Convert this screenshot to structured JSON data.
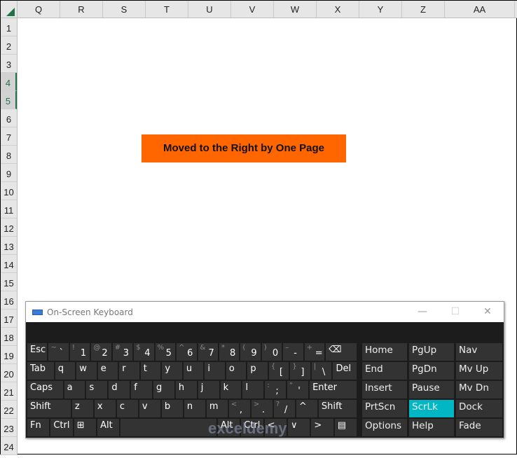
{
  "sheet": {
    "columns": [
      "Q",
      "R",
      "S",
      "T",
      "U",
      "V",
      "W",
      "X",
      "Y",
      "Z",
      "AA"
    ],
    "rows": [
      "1",
      "2",
      "3",
      "4",
      "5",
      "6",
      "7",
      "8",
      "9",
      "10",
      "11",
      "12",
      "13",
      "14",
      "15",
      "16",
      "17",
      "18",
      "19",
      "20",
      "21",
      "22",
      "23",
      "24"
    ],
    "selected_rows": [
      "4",
      "5"
    ],
    "banner": "Moved to the Right by One Page",
    "accent": "#ff6600"
  },
  "osk": {
    "title": "On-Screen Keyboard",
    "minimize": "—",
    "maximize": "☐",
    "close": "✕",
    "rows": [
      [
        [
          "Esc",
          "",
          1
        ],
        [
          "`",
          "~",
          1
        ],
        [
          "1",
          "!",
          1
        ],
        [
          "2",
          "@",
          1
        ],
        [
          "3",
          "#",
          1
        ],
        [
          "4",
          "$",
          1
        ],
        [
          "5",
          "%",
          1
        ],
        [
          "6",
          "^",
          1
        ],
        [
          "7",
          "&",
          1
        ],
        [
          "8",
          "*",
          1
        ],
        [
          "9",
          "(",
          1
        ],
        [
          "0",
          ")",
          1
        ],
        [
          "-",
          "–",
          1
        ],
        [
          "=",
          "+",
          1
        ],
        [
          "⌫",
          "",
          1.75
        ]
      ],
      [
        [
          "Tab",
          "",
          1.45
        ],
        [
          "q",
          "",
          1
        ],
        [
          "w",
          "",
          1
        ],
        [
          "e",
          "",
          1
        ],
        [
          "r",
          "",
          1
        ],
        [
          "t",
          "",
          1
        ],
        [
          "y",
          "",
          1
        ],
        [
          "u",
          "",
          1
        ],
        [
          "i",
          "",
          1
        ],
        [
          "o",
          "",
          1
        ],
        [
          "p",
          "",
          1
        ],
        [
          "[",
          "{",
          1
        ],
        [
          "]",
          "}",
          1
        ],
        [
          "\\",
          "|",
          1
        ],
        [
          "Del",
          "",
          1.25
        ]
      ],
      [
        [
          "Caps",
          "",
          1.95
        ],
        [
          "a",
          "",
          1
        ],
        [
          "s",
          "",
          1
        ],
        [
          "d",
          "",
          1
        ],
        [
          "f",
          "",
          1
        ],
        [
          "g",
          "",
          1
        ],
        [
          "h",
          "",
          1
        ],
        [
          "j",
          "",
          1
        ],
        [
          "k",
          "",
          1
        ],
        [
          "l",
          "",
          1
        ],
        [
          ";",
          ":",
          1
        ],
        [
          "'",
          "\"",
          1
        ],
        [
          "Enter",
          "",
          2.7
        ]
      ],
      [
        [
          "Shift",
          "",
          2.45
        ],
        [
          "z",
          "",
          1
        ],
        [
          "x",
          "",
          1
        ],
        [
          "c",
          "",
          1
        ],
        [
          "v",
          "",
          1
        ],
        [
          "b",
          "",
          1
        ],
        [
          "n",
          "",
          1
        ],
        [
          "m",
          "",
          1
        ],
        [
          ",",
          "<",
          1
        ],
        [
          ".",
          ">",
          1
        ],
        [
          "/",
          "?",
          1
        ],
        [
          "^",
          "",
          1
        ],
        [
          "Shift",
          "",
          2.1
        ]
      ],
      [
        [
          "Fn",
          "",
          1
        ],
        [
          "Ctrl",
          "",
          1
        ],
        [
          "⊞",
          "",
          1
        ],
        [
          "Alt",
          "",
          1
        ],
        [
          "",
          "",
          5.5
        ],
        [
          "Alt",
          "",
          1
        ],
        [
          "Ctrl",
          "",
          1
        ],
        [
          "<",
          "",
          1
        ],
        [
          "∨",
          "",
          1
        ],
        [
          ">",
          "",
          1
        ],
        [
          "▤",
          "",
          1
        ]
      ]
    ],
    "nav": [
      "Home",
      "PgUp",
      "Nav",
      "End",
      "PgDn",
      "Mv Up",
      "Insert",
      "Pause",
      "Mv Dn",
      "PrtScn",
      "ScrLk",
      "Dock",
      "Options",
      "Help",
      "Fade"
    ],
    "active_key": "ScrLk",
    "active_color": "#00b7c3"
  },
  "watermark": "exceldemy"
}
